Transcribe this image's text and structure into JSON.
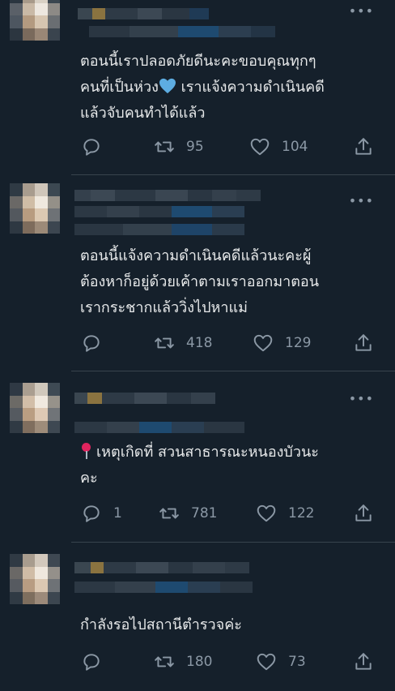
{
  "tweets": [
    {
      "text_lines": [
        "ตอนนี้เราปลอดภัยดีนะคะขอบคุณทุกๆ",
        "คนที่เป็นห่วง",
        "เราแจ้งความดำเนินคดี",
        "แล้วจับคนทำได้แล้ว"
      ],
      "reply_count": "",
      "retweet_count": "95",
      "like_count": "104",
      "more_label": "•••"
    },
    {
      "text_lines": [
        "ตอนนี้แจ้งความดำเนินคดีแล้วนะคะผู้",
        "ต้องหาก็อยู่ด้วยเค้าตามเราออกมาตอน",
        "เรากระชากแล้ววิ่งไปหาแม่"
      ],
      "reply_count": "",
      "retweet_count": "418",
      "like_count": "129",
      "more_label": "•••"
    },
    {
      "text_lines": [
        "เหตุเกิดที่ สวนสาธารณะหนองบัวนะ",
        "คะ"
      ],
      "reply_count": "1",
      "retweet_count": "781",
      "like_count": "122",
      "more_label": "•••"
    },
    {
      "text_lines": [
        "กำลังรอไปสถานีตำรวจค่ะ"
      ],
      "reply_count": "",
      "retweet_count": "180",
      "like_count": "73",
      "more_label": "•••"
    }
  ],
  "colors": {
    "background": "#15202b",
    "text": "#e7e9ea",
    "muted": "#8b98a5",
    "divider": "#38444d",
    "heart_emoji": "#5dade2",
    "pin": "#e0245e"
  },
  "icons": [
    "reply-icon",
    "retweet-icon",
    "like-icon",
    "share-icon",
    "more-icon",
    "round-pushpin-emoji",
    "light-blue-heart-emoji"
  ]
}
